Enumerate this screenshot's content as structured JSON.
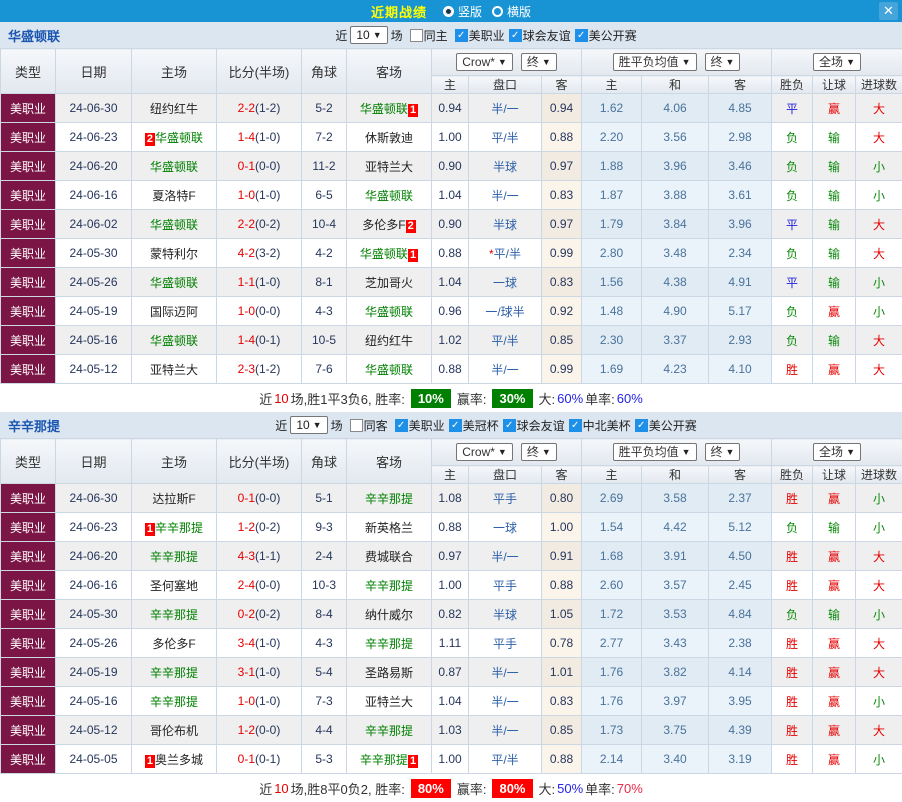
{
  "titlebar": {
    "title": "近期战绩",
    "radio_vertical": "竖版",
    "radio_horizontal": "横版",
    "close": "✕"
  },
  "table_header": {
    "type": "类型",
    "date": "日期",
    "home": "主场",
    "score": "比分(半场)",
    "corner": "角球",
    "away": "客场",
    "dd_crow": "Crow*",
    "dd_final1": "终",
    "dd_avg": "胜平负均值",
    "dd_final2": "终",
    "dd_full": "全场",
    "sub_home": "主",
    "sub_handicap": "盘口",
    "sub_away": "客",
    "sub_avg_home": "主",
    "sub_avg_draw": "和",
    "sub_avg_away": "客",
    "outcome": "胜负",
    "let_ball": "让球",
    "goals": "进球数"
  },
  "colors": {
    "titlebar_blue": "#1893D4",
    "title_yellow": "#FFFF00",
    "section_bar": "#DCE6F1",
    "league_maroon": "#7A1545",
    "team_green": "#008000",
    "score_red": "#E60000",
    "handicap_blue": "#2D5FA8",
    "avg_bg": "#EAF3FA",
    "win_red": "#E60000",
    "draw_blue": "#2323D9",
    "lose_green": "#0B8A0B",
    "badge_green": "#008000",
    "badge_red": "#FF0000"
  },
  "sections": [
    {
      "team": "华盛顿联",
      "filter": {
        "near": "近",
        "count": "10",
        "games": "场",
        "same": {
          "label": "同主",
          "state": "off"
        },
        "comps": [
          {
            "label": "美职业",
            "state": "on"
          },
          {
            "label": "球会友谊",
            "state": "on"
          },
          {
            "label": "美公开赛",
            "state": "on"
          }
        ]
      },
      "rows": [
        {
          "type": "美职业",
          "date": "24-06-30",
          "home_pre": "",
          "home": "纽约红牛",
          "home_post": "",
          "home_color": "black",
          "score": "2-2",
          "half": "(1-2)",
          "corner": "5-2",
          "away_pre": "",
          "away": "华盛顿联",
          "away_post": "1",
          "away_color": "green",
          "o_home": "0.94",
          "hcp_star": "",
          "hcp": "半/一",
          "o_away": "0.94",
          "avg_h": "1.62",
          "avg_d": "4.06",
          "avg_a": "4.85",
          "res": "平",
          "res_c": "blue",
          "let": "赢",
          "let_c": "red",
          "goal": "大",
          "goal_c": "red"
        },
        {
          "type": "美职业",
          "date": "24-06-23",
          "home_pre": "2",
          "home": "华盛顿联",
          "home_post": "",
          "home_color": "green",
          "score": "1-4",
          "half": "(1-0)",
          "corner": "7-2",
          "away_pre": "",
          "away": "休斯敦迪",
          "away_post": "",
          "away_color": "black",
          "o_home": "1.00",
          "hcp_star": "",
          "hcp": "平/半",
          "o_away": "0.88",
          "avg_h": "2.20",
          "avg_d": "3.56",
          "avg_a": "2.98",
          "res": "负",
          "res_c": "green",
          "let": "输",
          "let_c": "green",
          "goal": "大",
          "goal_c": "red"
        },
        {
          "type": "美职业",
          "date": "24-06-20",
          "home_pre": "",
          "home": "华盛顿联",
          "home_post": "",
          "home_color": "green",
          "score": "0-1",
          "half": "(0-0)",
          "corner": "11-2",
          "away_pre": "",
          "away": "亚特兰大",
          "away_post": "",
          "away_color": "black",
          "o_home": "0.90",
          "hcp_star": "",
          "hcp": "半球",
          "o_away": "0.97",
          "avg_h": "1.88",
          "avg_d": "3.96",
          "avg_a": "3.46",
          "res": "负",
          "res_c": "green",
          "let": "输",
          "let_c": "green",
          "goal": "小",
          "goal_c": "green"
        },
        {
          "type": "美职业",
          "date": "24-06-16",
          "home_pre": "",
          "home": "夏洛特F",
          "home_post": "",
          "home_color": "black",
          "score": "1-0",
          "half": "(1-0)",
          "corner": "6-5",
          "away_pre": "",
          "away": "华盛顿联",
          "away_post": "",
          "away_color": "green",
          "o_home": "1.04",
          "hcp_star": "",
          "hcp": "半/一",
          "o_away": "0.83",
          "avg_h": "1.87",
          "avg_d": "3.88",
          "avg_a": "3.61",
          "res": "负",
          "res_c": "green",
          "let": "输",
          "let_c": "green",
          "goal": "小",
          "goal_c": "green"
        },
        {
          "type": "美职业",
          "date": "24-06-02",
          "home_pre": "",
          "home": "华盛顿联",
          "home_post": "",
          "home_color": "green",
          "score": "2-2",
          "half": "(0-2)",
          "corner": "10-4",
          "away_pre": "",
          "away": "多伦多F",
          "away_post": "2",
          "away_color": "black",
          "o_home": "0.90",
          "hcp_star": "",
          "hcp": "半球",
          "o_away": "0.97",
          "avg_h": "1.79",
          "avg_d": "3.84",
          "avg_a": "3.96",
          "res": "平",
          "res_c": "blue",
          "let": "输",
          "let_c": "green",
          "goal": "大",
          "goal_c": "red"
        },
        {
          "type": "美职业",
          "date": "24-05-30",
          "home_pre": "",
          "home": "蒙特利尔",
          "home_post": "",
          "home_color": "black",
          "score": "4-2",
          "half": "(3-2)",
          "corner": "4-2",
          "away_pre": "",
          "away": "华盛顿联",
          "away_post": "1",
          "away_color": "green",
          "o_home": "0.88",
          "hcp_star": "*",
          "hcp": "平/半",
          "o_away": "0.99",
          "avg_h": "2.80",
          "avg_d": "3.48",
          "avg_a": "2.34",
          "res": "负",
          "res_c": "green",
          "let": "输",
          "let_c": "green",
          "goal": "大",
          "goal_c": "red"
        },
        {
          "type": "美职业",
          "date": "24-05-26",
          "home_pre": "",
          "home": "华盛顿联",
          "home_post": "",
          "home_color": "green",
          "score": "1-1",
          "half": "(1-0)",
          "corner": "8-1",
          "away_pre": "",
          "away": "芝加哥火",
          "away_post": "",
          "away_color": "black",
          "o_home": "1.04",
          "hcp_star": "",
          "hcp": "一球",
          "o_away": "0.83",
          "avg_h": "1.56",
          "avg_d": "4.38",
          "avg_a": "4.91",
          "res": "平",
          "res_c": "blue",
          "let": "输",
          "let_c": "green",
          "goal": "小",
          "goal_c": "green"
        },
        {
          "type": "美职业",
          "date": "24-05-19",
          "home_pre": "",
          "home": "国际迈阿",
          "home_post": "",
          "home_color": "black",
          "score": "1-0",
          "half": "(0-0)",
          "corner": "4-3",
          "away_pre": "",
          "away": "华盛顿联",
          "away_post": "",
          "away_color": "green",
          "o_home": "0.96",
          "hcp_star": "",
          "hcp": "一/球半",
          "o_away": "0.92",
          "avg_h": "1.48",
          "avg_d": "4.90",
          "avg_a": "5.17",
          "res": "负",
          "res_c": "green",
          "let": "赢",
          "let_c": "red",
          "goal": "小",
          "goal_c": "green"
        },
        {
          "type": "美职业",
          "date": "24-05-16",
          "home_pre": "",
          "home": "华盛顿联",
          "home_post": "",
          "home_color": "green",
          "score": "1-4",
          "half": "(0-1)",
          "corner": "10-5",
          "away_pre": "",
          "away": "纽约红牛",
          "away_post": "",
          "away_color": "black",
          "o_home": "1.02",
          "hcp_star": "",
          "hcp": "平/半",
          "o_away": "0.85",
          "avg_h": "2.30",
          "avg_d": "3.37",
          "avg_a": "2.93",
          "res": "负",
          "res_c": "green",
          "let": "输",
          "let_c": "green",
          "goal": "大",
          "goal_c": "red"
        },
        {
          "type": "美职业",
          "date": "24-05-12",
          "home_pre": "",
          "home": "亚特兰大",
          "home_post": "",
          "home_color": "black",
          "score": "2-3",
          "half": "(1-2)",
          "corner": "7-6",
          "away_pre": "",
          "away": "华盛顿联",
          "away_post": "",
          "away_color": "green",
          "o_home": "0.88",
          "hcp_star": "",
          "hcp": "半/一",
          "o_away": "0.99",
          "avg_h": "1.69",
          "avg_d": "4.23",
          "avg_a": "4.10",
          "res": "胜",
          "res_c": "red",
          "let": "赢",
          "let_c": "red",
          "goal": "大",
          "goal_c": "red"
        }
      ],
      "summary": {
        "near": "近",
        "count": "10",
        "mid": "场,胜1平3负6, 胜率:",
        "rate1": "10%",
        "rate1_style": "badge-green",
        "label2": "赢率:",
        "rate2": "30%",
        "rate2_style": "badge-green",
        "label3": "大:",
        "val3": "60%",
        "val3_style": "b",
        "label4": "单率:",
        "val4": "60%",
        "val4_style": "b"
      }
    },
    {
      "team": "辛辛那提",
      "filter": {
        "near": "近",
        "count": "10",
        "games": "场",
        "same": {
          "label": "同客",
          "state": "off"
        },
        "comps": [
          {
            "label": "美职业",
            "state": "on"
          },
          {
            "label": "美冠杯",
            "state": "on"
          },
          {
            "label": "球会友谊",
            "state": "on"
          },
          {
            "label": "中北美杯",
            "state": "on"
          },
          {
            "label": "美公开赛",
            "state": "on"
          }
        ]
      },
      "rows": [
        {
          "type": "美职业",
          "date": "24-06-30",
          "home_pre": "",
          "home": "达拉斯F",
          "home_post": "",
          "home_color": "black",
          "score": "0-1",
          "half": "(0-0)",
          "corner": "5-1",
          "away_pre": "",
          "away": "辛辛那提",
          "away_post": "",
          "away_color": "green",
          "o_home": "1.08",
          "hcp_star": "",
          "hcp": "平手",
          "o_away": "0.80",
          "avg_h": "2.69",
          "avg_d": "3.58",
          "avg_a": "2.37",
          "res": "胜",
          "res_c": "red",
          "let": "赢",
          "let_c": "red",
          "goal": "小",
          "goal_c": "green"
        },
        {
          "type": "美职业",
          "date": "24-06-23",
          "home_pre": "1",
          "home": "辛辛那提",
          "home_post": "",
          "home_color": "green",
          "score": "1-2",
          "half": "(0-2)",
          "corner": "9-3",
          "away_pre": "",
          "away": "新英格兰",
          "away_post": "",
          "away_color": "black",
          "o_home": "0.88",
          "hcp_star": "",
          "hcp": "一球",
          "o_away": "1.00",
          "avg_h": "1.54",
          "avg_d": "4.42",
          "avg_a": "5.12",
          "res": "负",
          "res_c": "green",
          "let": "输",
          "let_c": "green",
          "goal": "小",
          "goal_c": "green"
        },
        {
          "type": "美职业",
          "date": "24-06-20",
          "home_pre": "",
          "home": "辛辛那提",
          "home_post": "",
          "home_color": "green",
          "score": "4-3",
          "half": "(1-1)",
          "corner": "2-4",
          "away_pre": "",
          "away": "费城联合",
          "away_post": "",
          "away_color": "black",
          "o_home": "0.97",
          "hcp_star": "",
          "hcp": "半/一",
          "o_away": "0.91",
          "avg_h": "1.68",
          "avg_d": "3.91",
          "avg_a": "4.50",
          "res": "胜",
          "res_c": "red",
          "let": "赢",
          "let_c": "red",
          "goal": "大",
          "goal_c": "red"
        },
        {
          "type": "美职业",
          "date": "24-06-16",
          "home_pre": "",
          "home": "圣何塞地",
          "home_post": "",
          "home_color": "black",
          "score": "2-4",
          "half": "(0-0)",
          "corner": "10-3",
          "away_pre": "",
          "away": "辛辛那提",
          "away_post": "",
          "away_color": "green",
          "o_home": "1.00",
          "hcp_star": "",
          "hcp": "平手",
          "o_away": "0.88",
          "avg_h": "2.60",
          "avg_d": "3.57",
          "avg_a": "2.45",
          "res": "胜",
          "res_c": "red",
          "let": "赢",
          "let_c": "red",
          "goal": "大",
          "goal_c": "red"
        },
        {
          "type": "美职业",
          "date": "24-05-30",
          "home_pre": "",
          "home": "辛辛那提",
          "home_post": "",
          "home_color": "green",
          "score": "0-2",
          "half": "(0-2)",
          "corner": "8-4",
          "away_pre": "",
          "away": "纳什威尔",
          "away_post": "",
          "away_color": "black",
          "o_home": "0.82",
          "hcp_star": "",
          "hcp": "半球",
          "o_away": "1.05",
          "avg_h": "1.72",
          "avg_d": "3.53",
          "avg_a": "4.84",
          "res": "负",
          "res_c": "green",
          "let": "输",
          "let_c": "green",
          "goal": "小",
          "goal_c": "green"
        },
        {
          "type": "美职业",
          "date": "24-05-26",
          "home_pre": "",
          "home": "多伦多F",
          "home_post": "",
          "home_color": "black",
          "score": "3-4",
          "half": "(1-0)",
          "corner": "4-3",
          "away_pre": "",
          "away": "辛辛那提",
          "away_post": "",
          "away_color": "green",
          "o_home": "1.11",
          "hcp_star": "",
          "hcp": "平手",
          "o_away": "0.78",
          "avg_h": "2.77",
          "avg_d": "3.43",
          "avg_a": "2.38",
          "res": "胜",
          "res_c": "red",
          "let": "赢",
          "let_c": "red",
          "goal": "大",
          "goal_c": "red"
        },
        {
          "type": "美职业",
          "date": "24-05-19",
          "home_pre": "",
          "home": "辛辛那提",
          "home_post": "",
          "home_color": "green",
          "score": "3-1",
          "half": "(1-0)",
          "corner": "5-4",
          "away_pre": "",
          "away": "圣路易斯",
          "away_post": "",
          "away_color": "black",
          "o_home": "0.87",
          "hcp_star": "",
          "hcp": "半/一",
          "o_away": "1.01",
          "avg_h": "1.76",
          "avg_d": "3.82",
          "avg_a": "4.14",
          "res": "胜",
          "res_c": "red",
          "let": "赢",
          "let_c": "red",
          "goal": "大",
          "goal_c": "red"
        },
        {
          "type": "美职业",
          "date": "24-05-16",
          "home_pre": "",
          "home": "辛辛那提",
          "home_post": "",
          "home_color": "green",
          "score": "1-0",
          "half": "(1-0)",
          "corner": "7-3",
          "away_pre": "",
          "away": "亚特兰大",
          "away_post": "",
          "away_color": "black",
          "o_home": "1.04",
          "hcp_star": "",
          "hcp": "半/一",
          "o_away": "0.83",
          "avg_h": "1.76",
          "avg_d": "3.97",
          "avg_a": "3.95",
          "res": "胜",
          "res_c": "red",
          "let": "赢",
          "let_c": "red",
          "goal": "小",
          "goal_c": "green"
        },
        {
          "type": "美职业",
          "date": "24-05-12",
          "home_pre": "",
          "home": "哥伦布机",
          "home_post": "",
          "home_color": "black",
          "score": "1-2",
          "half": "(0-0)",
          "corner": "4-4",
          "away_pre": "",
          "away": "辛辛那提",
          "away_post": "",
          "away_color": "green",
          "o_home": "1.03",
          "hcp_star": "",
          "hcp": "半/一",
          "o_away": "0.85",
          "avg_h": "1.73",
          "avg_d": "3.75",
          "avg_a": "4.39",
          "res": "胜",
          "res_c": "red",
          "let": "赢",
          "let_c": "red",
          "goal": "大",
          "goal_c": "red"
        },
        {
          "type": "美职业",
          "date": "24-05-05",
          "home_pre": "1",
          "home": "奥兰多城",
          "home_post": "",
          "home_color": "black",
          "score": "0-1",
          "half": "(0-1)",
          "corner": "5-3",
          "away_pre": "",
          "away": "辛辛那提",
          "away_post": "1",
          "away_color": "green",
          "o_home": "1.00",
          "hcp_star": "",
          "hcp": "平/半",
          "o_away": "0.88",
          "avg_h": "2.14",
          "avg_d": "3.40",
          "avg_a": "3.19",
          "res": "胜",
          "res_c": "red",
          "let": "赢",
          "let_c": "red",
          "goal": "小",
          "goal_c": "green"
        }
      ],
      "summary": {
        "near": "近",
        "count": "10",
        "mid": "场,胜8平0负2, 胜率:",
        "rate1": "80%",
        "rate1_style": "badge-red",
        "label2": "赢率:",
        "rate2": "80%",
        "rate2_style": "badge-red",
        "label3": "大:",
        "val3": "50%",
        "val3_style": "b",
        "label4": "单率:",
        "val4": "70%",
        "val4_style": "rt"
      }
    }
  ]
}
